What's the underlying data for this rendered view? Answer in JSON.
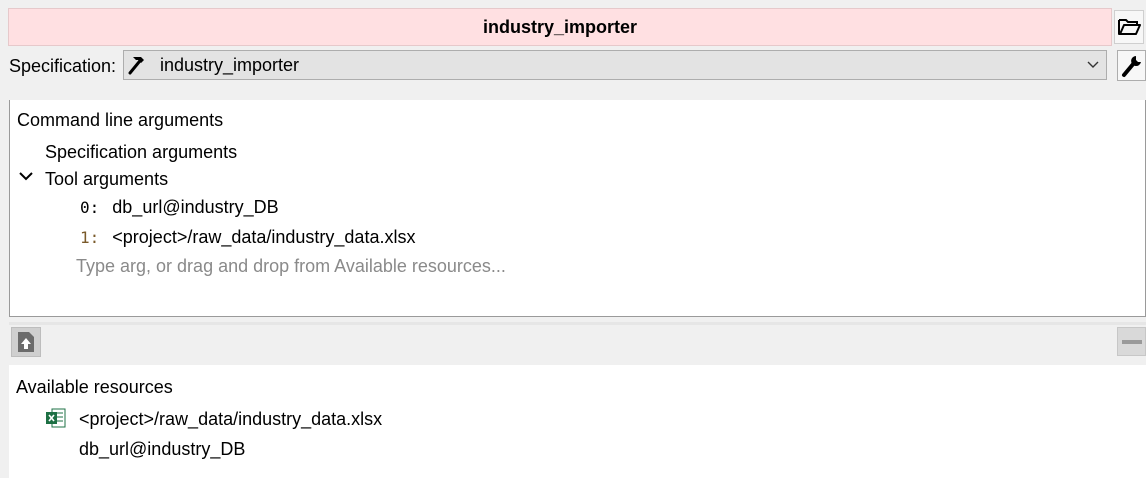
{
  "title": "industry_importer",
  "specification": {
    "label": "Specification:",
    "selected": "industry_importer"
  },
  "command_line": {
    "header": "Command line arguments",
    "spec_args_label": "Specification arguments",
    "tool_args_label": "Tool arguments",
    "tool_args": [
      {
        "index": "0:",
        "value": "db_url@industry_DB"
      },
      {
        "index": "1:",
        "value": "<project>/raw_data/industry_data.xlsx"
      }
    ],
    "placeholder": "Type arg, or drag and drop from Available resources..."
  },
  "resources": {
    "header": "Available resources",
    "items": [
      {
        "icon": "excel-file-icon",
        "label": "<project>/raw_data/industry_data.xlsx"
      },
      {
        "icon": "",
        "label": "db_url@industry_DB"
      }
    ]
  },
  "colors": {
    "title_bg": "#ffe0e2",
    "panel_bg": "#ffffff",
    "window_bg": "#f0f0f0",
    "excel_green": "#1d7044"
  }
}
